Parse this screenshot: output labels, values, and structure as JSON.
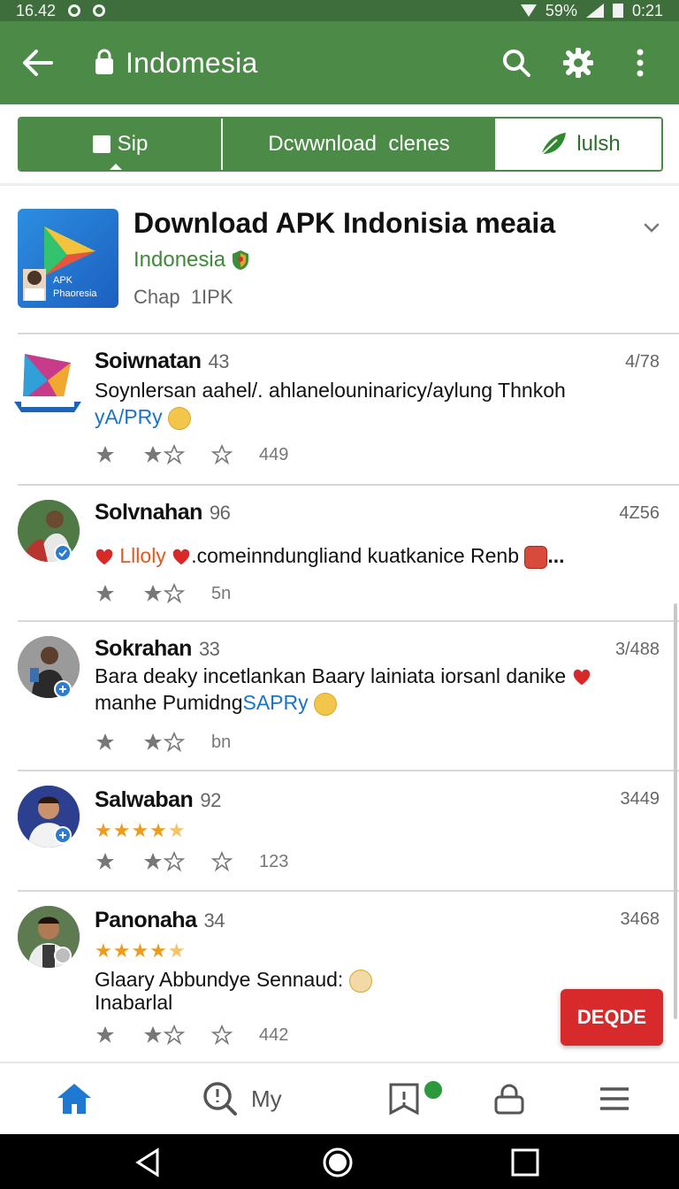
{
  "status_bar": {
    "time": "16.42",
    "battery": "59%",
    "right_time": "0:21"
  },
  "app_bar": {
    "title": "Indomesia"
  },
  "tabs": [
    {
      "label": "Sip"
    },
    {
      "label": "Dcwwnload  clenes"
    },
    {
      "label": "lulsh"
    }
  ],
  "app": {
    "icon_text": "APK Phaoresia",
    "name": "Download APK Indonisia meaia",
    "developer": "Indonesia",
    "meta": "Chap  1IPK"
  },
  "reviews": [
    {
      "name": "Soiwnatan",
      "num": "43",
      "date": "4/78",
      "text_line1": "Soynlersan aahel/. ahlanelouninaricy/aylung Thnkoh",
      "text_line2": "yA/PRy",
      "count": "449"
    },
    {
      "name": "Solvnahan",
      "num": "96",
      "date": "4Z56",
      "text_prefix": "Llloly",
      "text_main": ".comeinndungliand kuatkanice Renb",
      "text_suffix": "...",
      "count": "5n"
    },
    {
      "name": "Sokrahan",
      "num": "33",
      "date": "3/488",
      "text_line1": "Bara deaky incetlankan Baary lainiata iorsanl danike",
      "text_line2a": "manhe Pumidng",
      "text_line2b": "SAPRy",
      "count": "bn"
    },
    {
      "name": "Salwaban",
      "num": "92",
      "date": "3449",
      "rating": 4.5,
      "count": "123"
    },
    {
      "name": "Panonaha",
      "num": "34",
      "date": "3468",
      "rating": 4.5,
      "text_line1": "Glaary Abbundye Sennaud:",
      "text_line2": "Inabarlal",
      "count": "442"
    }
  ],
  "fab": {
    "label": "DEQDE"
  },
  "bottom_nav": {
    "my_label": "My"
  },
  "colors": {
    "primary": "#4c8a48",
    "accent": "#d82a2a",
    "link": "#1a73c9",
    "star": "#ef9b1c"
  }
}
